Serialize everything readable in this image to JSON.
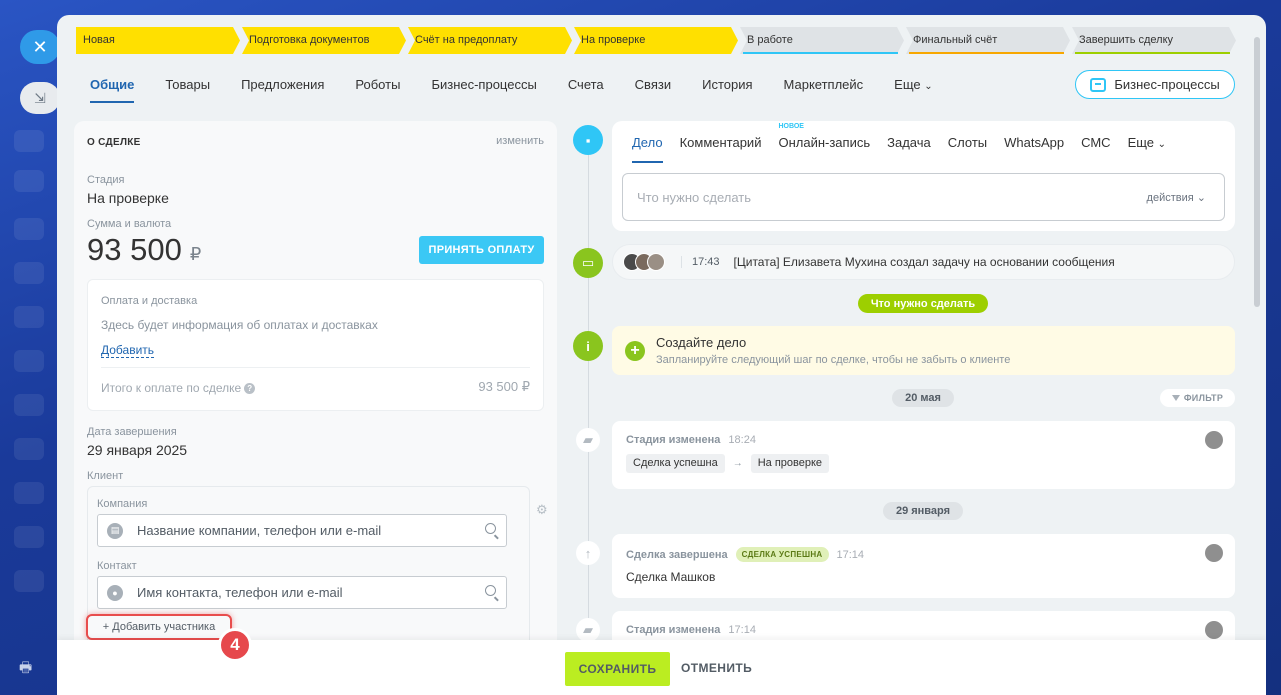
{
  "stages": [
    {
      "label": "Новая",
      "state": "active"
    },
    {
      "label": "Подготовка документов",
      "state": "active"
    },
    {
      "label": "Счёт на предоплату",
      "state": "active"
    },
    {
      "label": "На проверке",
      "state": "active"
    },
    {
      "label": "В работе",
      "state": "pending",
      "accent": "#2fc6f6"
    },
    {
      "label": "Финальный счёт",
      "state": "pending",
      "accent": "#f7a700"
    },
    {
      "label": "Завершить сделку",
      "state": "pending",
      "accent": "#9dcf00"
    }
  ],
  "tabs": [
    "Общие",
    "Товары",
    "Предложения",
    "Роботы",
    "Бизнес-процессы",
    "Счета",
    "Связи",
    "История",
    "Маркетплейс",
    "Еще"
  ],
  "bp_button": "Бизнес-процессы",
  "deal": {
    "title": "О СДЕЛКЕ",
    "edit": "изменить",
    "stage_label": "Стадия",
    "stage_value": "На проверке",
    "amount_label": "Сумма и валюта",
    "amount": "93 500",
    "currency": "₽",
    "pay_button": "ПРИНЯТЬ ОПЛАТУ",
    "payment": {
      "title": "Оплата и доставка",
      "info": "Здесь будет информация об оплатах и доставках",
      "add": "Добавить",
      "total_label": "Итого к оплате по сделке",
      "total_value": "93 500 ₽"
    },
    "end_date_label": "Дата завершения",
    "end_date": "29 января 2025",
    "client_label": "Клиент",
    "company_label": "Компания",
    "company_placeholder": "Название компании, телефон или e-mail",
    "contact_label": "Контакт",
    "contact_placeholder": "Имя контакта, телефон или e-mail",
    "add_member": "+ Добавить участника",
    "step_badge": "4"
  },
  "activity": {
    "tabs": [
      "Дело",
      "Комментарий",
      "Онлайн-запись",
      "Задача",
      "Слоты",
      "WhatsApp",
      "СМС",
      "Еще"
    ],
    "new_badge": "НОВОЕ",
    "input_placeholder": "Что нужно сделать",
    "actions": "действия"
  },
  "comment": {
    "time": "17:43",
    "text": "[Цитата] Елизавета Мухина создал задачу на основании сообщения"
  },
  "todo_pill": "Что нужно сделать",
  "todo": {
    "title": "Создайте дело",
    "subtitle": "Запланируйте следующий шаг по сделке, чтобы не забыть о клиенте"
  },
  "filter": "ФИЛЬТР",
  "history": [
    {
      "date": "20 мая"
    },
    {
      "title": "Стадия изменена",
      "time": "18:24",
      "from": "Сделка успешна",
      "to": "На проверке"
    },
    {
      "date": "29 января"
    },
    {
      "title": "Сделка завершена",
      "badge": "СДЕЛКА УСПЕШНА",
      "time": "17:14",
      "body": "Сделка Машков"
    },
    {
      "title": "Стадия изменена",
      "time": "17:14"
    }
  ],
  "footer": {
    "save": "СОХРАНИТЬ",
    "cancel": "ОТМЕНИТЬ"
  }
}
